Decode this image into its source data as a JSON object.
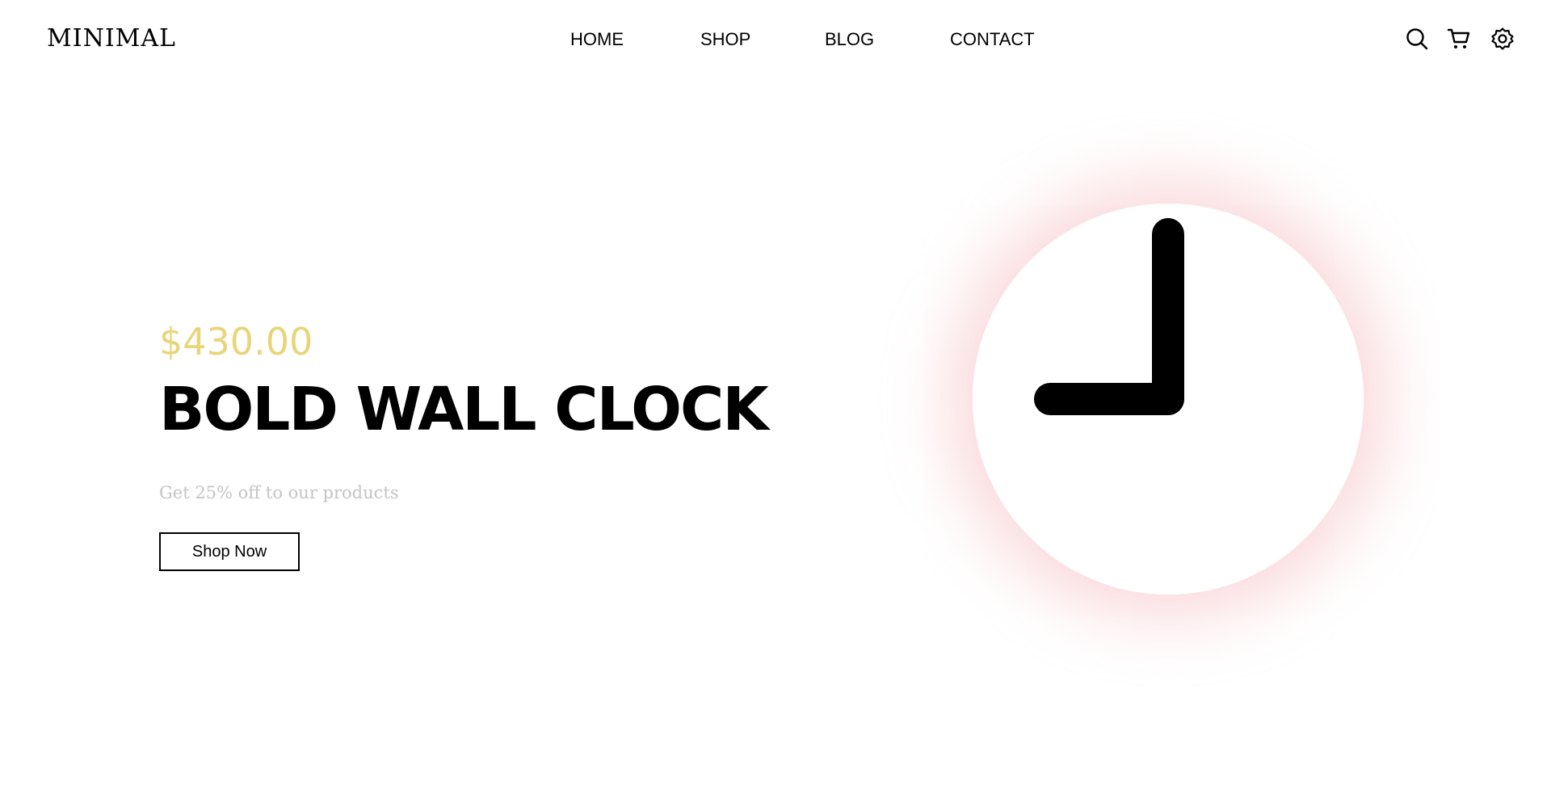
{
  "header": {
    "logo": "MINIMAL",
    "nav": {
      "home": "HOME",
      "shop": "SHOP",
      "blog": "BLOG",
      "contact": "CONTACT"
    },
    "icons": [
      "search-icon",
      "cart-icon",
      "settings-icon"
    ]
  },
  "hero": {
    "price": "$430.00",
    "title": "BOLD WALL CLOCK",
    "tagline": "Get 25% off to our products",
    "cta_label": "Shop Now"
  },
  "colors": {
    "price": "#e8d57a",
    "tagline": "#c4c4c4",
    "clock_glow": "#f5aaaf",
    "text": "#000000",
    "background": "#ffffff"
  }
}
